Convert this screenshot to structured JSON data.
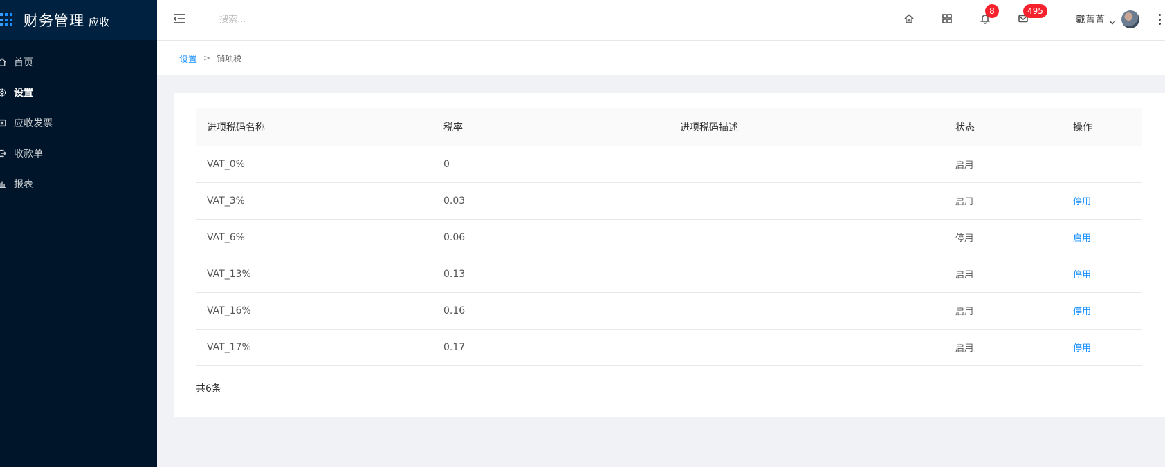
{
  "sidebar": {
    "brand_title": "财务管理",
    "brand_sub": "应收",
    "items": [
      {
        "label": "首页",
        "icon": "home-icon",
        "active": false
      },
      {
        "label": "设置",
        "icon": "gear-icon",
        "active": true
      },
      {
        "label": "应收发票",
        "icon": "invoice-icon",
        "active": false
      },
      {
        "label": "收款单",
        "icon": "receipt-icon",
        "active": false
      },
      {
        "label": "报表",
        "icon": "bar-chart-icon",
        "active": false
      }
    ]
  },
  "header": {
    "search_placeholder": "搜索...",
    "notifications_count": "8",
    "messages_count": "495",
    "user_name": "戴菁菁"
  },
  "breadcrumb": {
    "parent": "设置",
    "separator": ">",
    "current": "销项税"
  },
  "table": {
    "columns": [
      "进项税码名称",
      "税率",
      "进项税码描述",
      "状态",
      "操作"
    ],
    "rows": [
      {
        "name": "VAT_0%",
        "rate": "0",
        "desc": "",
        "status": "启用",
        "action": ""
      },
      {
        "name": "VAT_3%",
        "rate": "0.03",
        "desc": "",
        "status": "启用",
        "action": "停用"
      },
      {
        "name": "VAT_6%",
        "rate": "0.06",
        "desc": "",
        "status": "停用",
        "action": "启用"
      },
      {
        "name": "VAT_13%",
        "rate": "0.13",
        "desc": "",
        "status": "启用",
        "action": "停用"
      },
      {
        "name": "VAT_16%",
        "rate": "0.16",
        "desc": "",
        "status": "启用",
        "action": "停用"
      },
      {
        "name": "VAT_17%",
        "rate": "0.17",
        "desc": "",
        "status": "启用",
        "action": "停用"
      }
    ],
    "total": "共6条"
  },
  "colors": {
    "sidebar_bg": "#001529",
    "accent": "#1890ff",
    "badge": "#f5222d"
  }
}
